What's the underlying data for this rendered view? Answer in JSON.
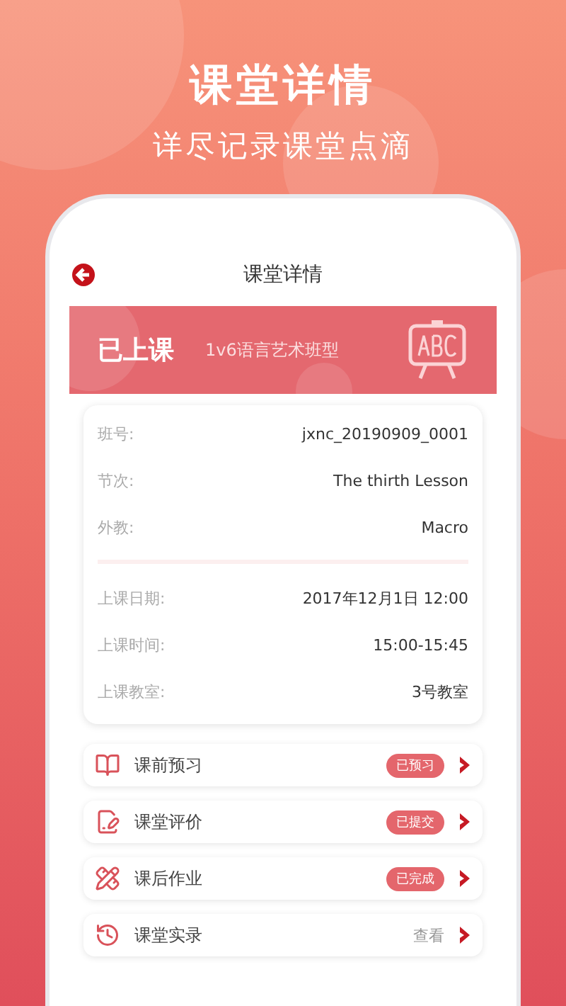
{
  "headline": "课堂详情",
  "subheadline": "详尽记录课堂点滴",
  "screen": {
    "title": "课堂详情",
    "banner": {
      "status": "已上课",
      "class_type": "1v6语言艺术班型"
    },
    "info_groups": [
      [
        {
          "label": "班号:",
          "value": "jxnc_20190909_0001"
        },
        {
          "label": "节次:",
          "value": "The thirth Lesson"
        },
        {
          "label": "外教:",
          "value": "Macro"
        }
      ],
      [
        {
          "label": "上课日期:",
          "value": "2017年12月1日 12:00"
        },
        {
          "label": "上课时间:",
          "value": "15:00-15:45"
        },
        {
          "label": "上课教室:",
          "value": "3号教室"
        }
      ]
    ],
    "links": [
      {
        "kind": "badge",
        "label": "课前预习",
        "status": "已预习"
      },
      {
        "kind": "badge",
        "label": "课堂评价",
        "status": "已提交"
      },
      {
        "kind": "badge",
        "label": "课后作业",
        "status": "已完成"
      },
      {
        "kind": "link",
        "label": "课堂实录",
        "status": "查看"
      }
    ]
  }
}
